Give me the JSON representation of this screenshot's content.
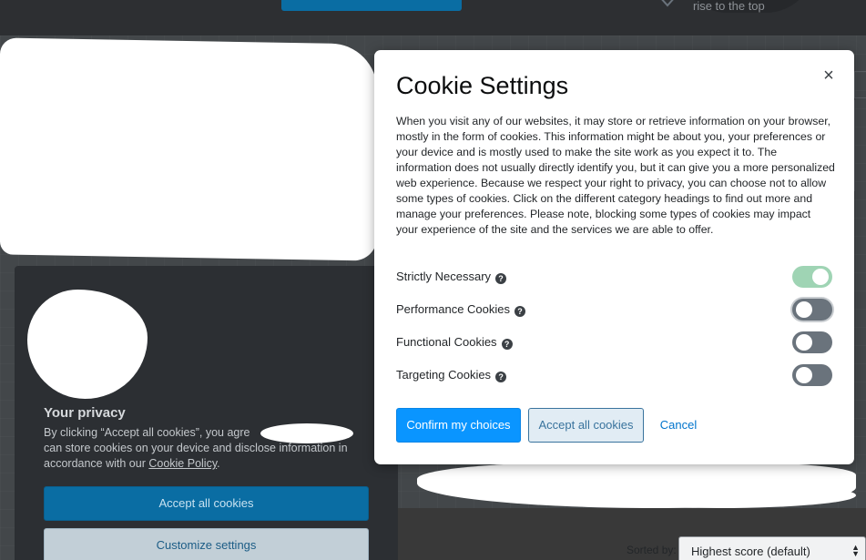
{
  "topbar": {
    "hint_text": "rise to the top"
  },
  "background": {
    "sort_label": "Sorted by:",
    "sort_value": "Highest score (default)"
  },
  "privacy_panel": {
    "title": "Your privacy",
    "text_before_link": "By clicking “Accept all cookies”, you agre",
    "text_line_2": "can store cookies on your device and disclose information in accordance with our ",
    "link": "Cookie Policy",
    "text_after_link": ".",
    "accept_button": "Accept all cookies",
    "customize_button": "Customize settings"
  },
  "modal": {
    "title": "Cookie Settings",
    "close_glyph": "×",
    "description": "When you visit any of our websites, it may store or retrieve information on your browser, mostly in the form of cookies. This information might be about you, your preferences or your device and is mostly used to make the site work as you expect it to. The information does not usually directly identify you, but it can give you a more personalized web experience. Because we respect your right to privacy, you can choose not to allow some types of cookies. Click on the different category headings to find out more and manage your preferences. Please note, blocking some types of cookies may impact your experience of the site and the services we are able to offer.",
    "help_glyph": "?",
    "categories": [
      {
        "label": "Strictly Necessary",
        "enabled": true
      },
      {
        "label": "Performance Cookies",
        "enabled": false
      },
      {
        "label": "Functional Cookies",
        "enabled": false
      },
      {
        "label": "Targeting Cookies",
        "enabled": false
      }
    ],
    "confirm_button": "Confirm my choices",
    "accept_all_button": "Accept all cookies",
    "cancel_button": "Cancel"
  },
  "colors": {
    "primary_blue": "#0a95ff",
    "toggle_on": "#9fd4b4",
    "toggle_off": "#6a737c",
    "dark_panel": "#2c2f33"
  }
}
